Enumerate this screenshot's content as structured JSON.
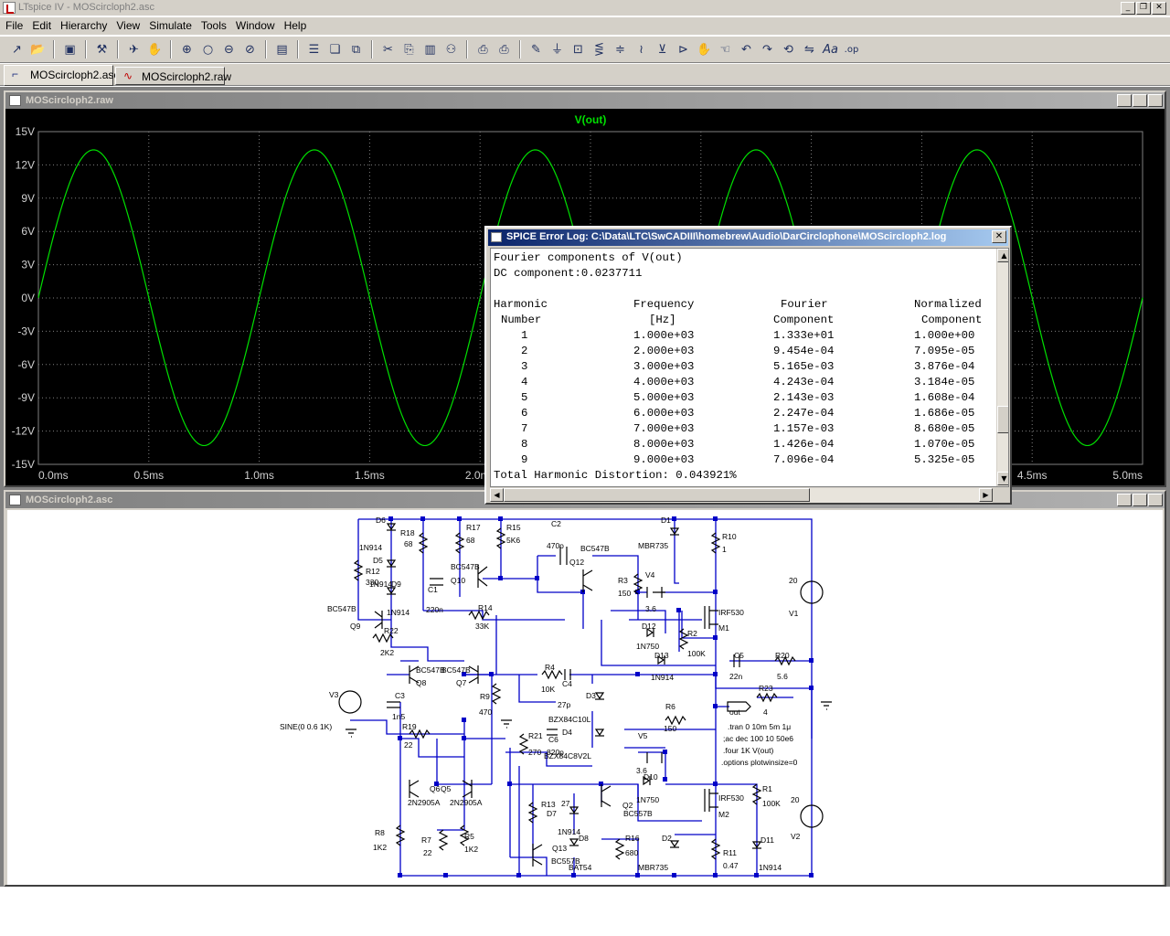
{
  "app": {
    "title": "LTspice IV - MOScircloph2.asc",
    "caption_buttons": [
      "_",
      "❐",
      "✕"
    ]
  },
  "menu": [
    "File",
    "Edit",
    "Hierarchy",
    "View",
    "Simulate",
    "Tools",
    "Window",
    "Help"
  ],
  "toolbar_icons": [
    "new-schematic",
    "open",
    "save",
    "control-panel",
    "run",
    "halt",
    "zoom-in",
    "pan",
    "zoom-out",
    "zoom-fit",
    "tile-horizontal",
    "cascade",
    "tile-vertical",
    "cut",
    "copy",
    "paste",
    "find",
    "print-setup",
    "print",
    "draw-wire",
    "ground",
    "label-net",
    "resistor",
    "capacitor",
    "inductor",
    "diode",
    "component",
    "move",
    "drag",
    "undo",
    "redo",
    "rotate",
    "mirror",
    "text",
    "spice-directive"
  ],
  "tabs": [
    {
      "label": "MOScircloph2.asc",
      "active": true
    },
    {
      "label": "MOScircloph2.raw",
      "active": false
    }
  ],
  "plot_window": {
    "title": "MOScircloph2.raw",
    "trace_label": "V(out)",
    "trace_color": "#00e000",
    "y_ticks": [
      "15V",
      "12V",
      "9V",
      "6V",
      "3V",
      "0V",
      "-3V",
      "-6V",
      "-9V",
      "-12V",
      "-15V"
    ],
    "x_ticks": [
      "0.0ms",
      "0.5ms",
      "1.0ms",
      "1.5ms",
      "2.0ms",
      "2.5ms",
      "3.0ms",
      "3.5ms",
      "4.0ms",
      "4.5ms",
      "5.0ms"
    ]
  },
  "chart_data": {
    "type": "line",
    "series": [
      {
        "name": "V(out)",
        "function": "sine",
        "amplitude": 13.33,
        "frequency_hz": 1000,
        "dc_offset": 0.0237711
      }
    ],
    "xlim": [
      0,
      5
    ],
    "ylim": [
      -15,
      15
    ],
    "xunit": "ms",
    "yunit": "V",
    "grid": true
  },
  "schematic_window": {
    "title": "MOScircloph2.asc",
    "labels": [
      {
        "t": "D6"
      },
      {
        "t": "R18"
      },
      {
        "t": "68"
      },
      {
        "t": "R17"
      },
      {
        "t": "68"
      },
      {
        "t": "R15"
      },
      {
        "t": "5K6"
      },
      {
        "t": "C2"
      },
      {
        "t": "470p"
      },
      {
        "t": "Q12"
      },
      {
        "t": "BC547B"
      },
      {
        "t": "D1"
      },
      {
        "t": "MBR735"
      },
      {
        "t": "R10"
      },
      {
        "t": "1"
      },
      {
        "t": "1N914"
      },
      {
        "t": "D5"
      },
      {
        "t": "R12"
      },
      {
        "t": "330"
      },
      {
        "t": "1N914"
      },
      {
        "t": "D9"
      },
      {
        "t": "BC547B"
      },
      {
        "t": "Q10"
      },
      {
        "t": "C1"
      },
      {
        "t": "220n"
      },
      {
        "t": "R3"
      },
      {
        "t": "150"
      },
      {
        "t": "V4"
      },
      {
        "t": "3.6"
      },
      {
        "t": "20"
      },
      {
        "t": "V1"
      },
      {
        "t": "BC547B"
      },
      {
        "t": "1N914"
      },
      {
        "t": "R14"
      },
      {
        "t": "33K"
      },
      {
        "t": "IRF530"
      },
      {
        "t": "M1"
      },
      {
        "t": "Q9"
      },
      {
        "t": "R22"
      },
      {
        "t": "2K2"
      },
      {
        "t": "D12"
      },
      {
        "t": "1N750"
      },
      {
        "t": "R2"
      },
      {
        "t": "100K"
      },
      {
        "t": "D13"
      },
      {
        "t": "1N914"
      },
      {
        "t": "C5"
      },
      {
        "t": "22n"
      },
      {
        "t": "R20"
      },
      {
        "t": "5.6"
      },
      {
        "t": "BC547B"
      },
      {
        "t": "BC547B"
      },
      {
        "t": "Q8"
      },
      {
        "t": "Q7"
      },
      {
        "t": "R4"
      },
      {
        "t": "10K"
      },
      {
        "t": "C4"
      },
      {
        "t": "27p"
      },
      {
        "t": "D3"
      },
      {
        "t": "R23"
      },
      {
        "t": "4"
      },
      {
        "t": "V3"
      },
      {
        "t": "C3"
      },
      {
        "t": "1n5"
      },
      {
        "t": "R9"
      },
      {
        "t": "470"
      },
      {
        "t": "R6"
      },
      {
        "t": "150"
      },
      {
        "t": "out"
      },
      {
        "t": "SINE(0 0.6 1K)"
      },
      {
        "t": "R19"
      },
      {
        "t": "22"
      },
      {
        "t": "BZX84C10L"
      },
      {
        "t": "D4"
      },
      {
        "t": ".tran 0 10m 5m 1μ"
      },
      {
        "t": ";ac dec 100 10 50e6"
      },
      {
        "t": ".four 1K V(out)"
      },
      {
        "t": ".options plotwinsize=0"
      },
      {
        "t": "R21"
      },
      {
        "t": "C6"
      },
      {
        "t": "270"
      },
      {
        "t": "820p"
      },
      {
        "t": "BZX84C8V2L"
      },
      {
        "t": "V5"
      },
      {
        "t": "3.6"
      },
      {
        "t": "Q6"
      },
      {
        "t": "Q5"
      },
      {
        "t": "2N2905A"
      },
      {
        "t": "2N2905A"
      },
      {
        "t": "D10"
      },
      {
        "t": "1N750"
      },
      {
        "t": "Q2"
      },
      {
        "t": "BC557B"
      },
      {
        "t": "IRF530"
      },
      {
        "t": "M2"
      },
      {
        "t": "R1"
      },
      {
        "t": "100K"
      },
      {
        "t": "20"
      },
      {
        "t": "V2"
      },
      {
        "t": "R13"
      },
      {
        "t": "27"
      },
      {
        "t": "D7"
      },
      {
        "t": "1N914"
      },
      {
        "t": "R8"
      },
      {
        "t": "1K2"
      },
      {
        "t": "R7"
      },
      {
        "t": "22"
      },
      {
        "t": "R5"
      },
      {
        "t": "1K2"
      },
      {
        "t": "Q13"
      },
      {
        "t": "BC557B"
      },
      {
        "t": "D8"
      },
      {
        "t": "BAT54"
      },
      {
        "t": "R16"
      },
      {
        "t": "680"
      },
      {
        "t": "D2"
      },
      {
        "t": "MBR735"
      },
      {
        "t": "R11"
      },
      {
        "t": "0.47"
      },
      {
        "t": "D11"
      },
      {
        "t": "1N914"
      }
    ]
  },
  "error_log": {
    "title": "SPICE Error Log: C:\\Data\\LTC\\SwCADIII\\homebrew\\Audio\\DarCirclophone\\MOScircloph2.log",
    "close_label": "✕",
    "line1": "Fourier components of V(out)",
    "line2": "DC component:0.0237711",
    "headers1": [
      "Harmonic",
      "Frequency",
      "Fourier",
      "Normalized"
    ],
    "headers2": [
      "Number",
      "[Hz]",
      "Component",
      "Component"
    ],
    "rows": [
      [
        "1",
        "1.000e+03",
        "1.333e+01",
        "1.000e+00"
      ],
      [
        "2",
        "2.000e+03",
        "9.454e-04",
        "7.095e-05"
      ],
      [
        "3",
        "3.000e+03",
        "5.165e-03",
        "3.876e-04"
      ],
      [
        "4",
        "4.000e+03",
        "4.243e-04",
        "3.184e-05"
      ],
      [
        "5",
        "5.000e+03",
        "2.143e-03",
        "1.608e-04"
      ],
      [
        "6",
        "6.000e+03",
        "2.247e-04",
        "1.686e-05"
      ],
      [
        "7",
        "7.000e+03",
        "1.157e-03",
        "8.680e-05"
      ],
      [
        "8",
        "8.000e+03",
        "1.426e-04",
        "1.070e-05"
      ],
      [
        "9",
        "9.000e+03",
        "7.096e-04",
        "5.325e-05"
      ]
    ],
    "thd": "Total Harmonic Distortion: 0.043921%"
  }
}
